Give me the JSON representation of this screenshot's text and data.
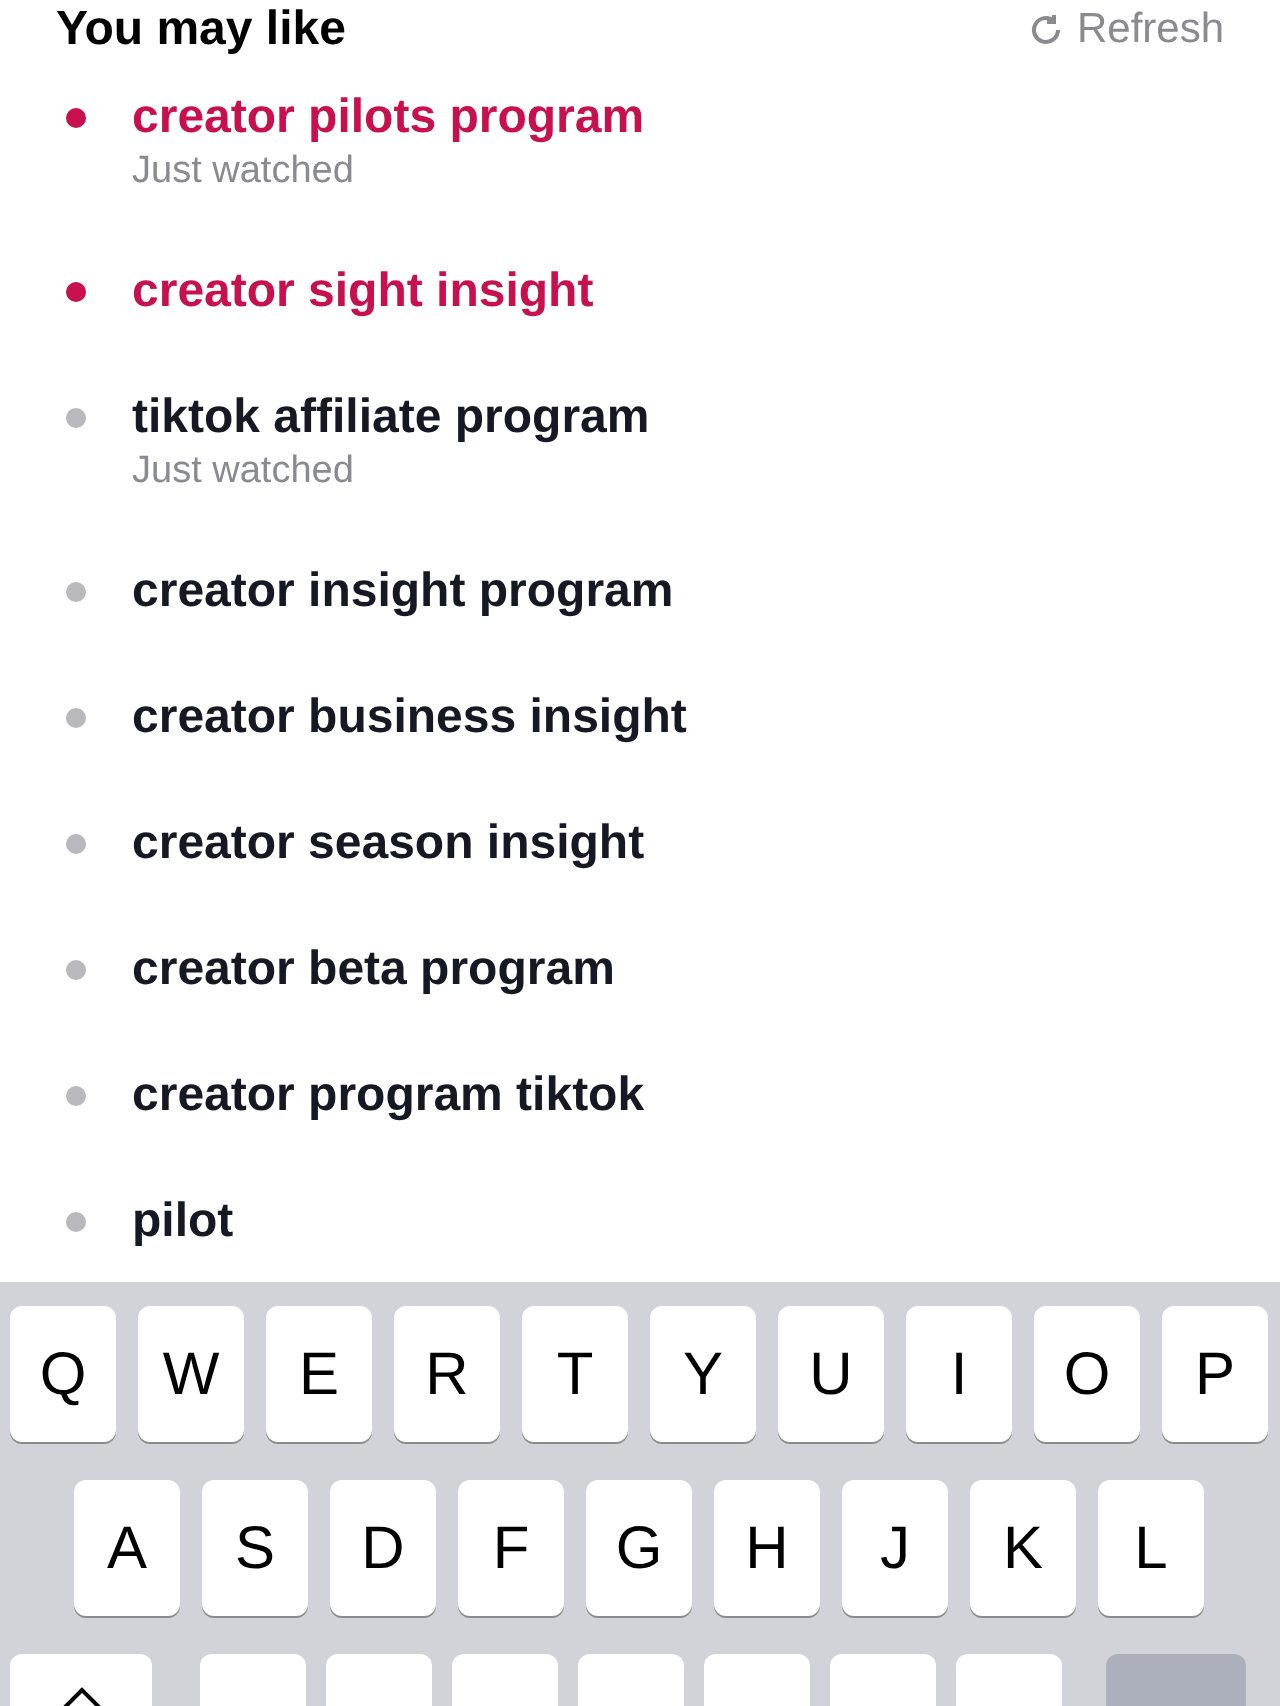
{
  "header": {
    "title": "You may like",
    "refresh": "Refresh"
  },
  "suggestions": [
    {
      "text": "creator pilots program",
      "highlighted": true,
      "subtitle": "Just watched"
    },
    {
      "text": "creator sight insight",
      "highlighted": true
    },
    {
      "text": "tiktok affiliate program",
      "highlighted": false,
      "subtitle": "Just watched"
    },
    {
      "text": "creator insight program",
      "highlighted": false
    },
    {
      "text": "creator business insight",
      "highlighted": false
    },
    {
      "text": "creator season insight",
      "highlighted": false
    },
    {
      "text": "creator beta program",
      "highlighted": false
    },
    {
      "text": "creator program tiktok",
      "highlighted": false
    },
    {
      "text": "pilot",
      "highlighted": false
    }
  ],
  "keyboard": {
    "rows": [
      [
        "Q",
        "W",
        "E",
        "R",
        "T",
        "Y",
        "U",
        "I",
        "O",
        "P"
      ],
      [
        "A",
        "S",
        "D",
        "F",
        "G",
        "H",
        "J",
        "K",
        "L"
      ]
    ]
  }
}
